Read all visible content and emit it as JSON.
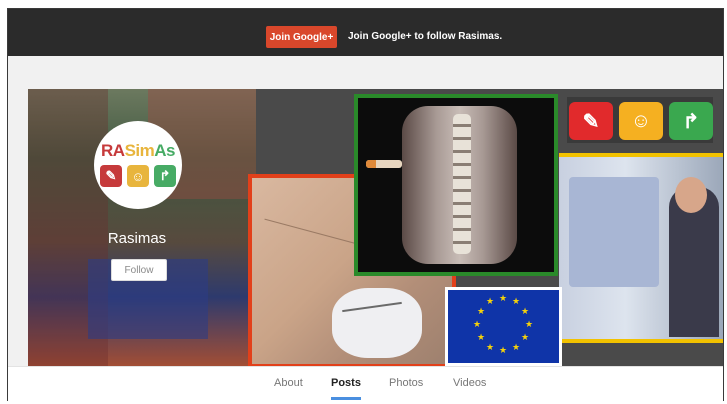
{
  "topbar": {
    "join_button_label": "Join Google+",
    "join_text": "Join Google+ to follow Rasimas."
  },
  "profile": {
    "logo_text": "RASimAs",
    "name": "Rasimas",
    "follow_label": "Follow"
  },
  "tabs": [
    {
      "label": "About",
      "active": false
    },
    {
      "label": "Posts",
      "active": true
    },
    {
      "label": "Photos",
      "active": false
    },
    {
      "label": "Videos",
      "active": false
    }
  ],
  "colors": {
    "topbar": "#2b2b2b",
    "join_button": "#d9472b",
    "active_tab_underline": "#4a8fe0",
    "logo_red": "#e23234",
    "logo_yellow": "#f4b41e",
    "logo_green": "#35b25a"
  },
  "icons": [
    "syringe-icon",
    "ultrasound-icon",
    "arrow-icon"
  ]
}
